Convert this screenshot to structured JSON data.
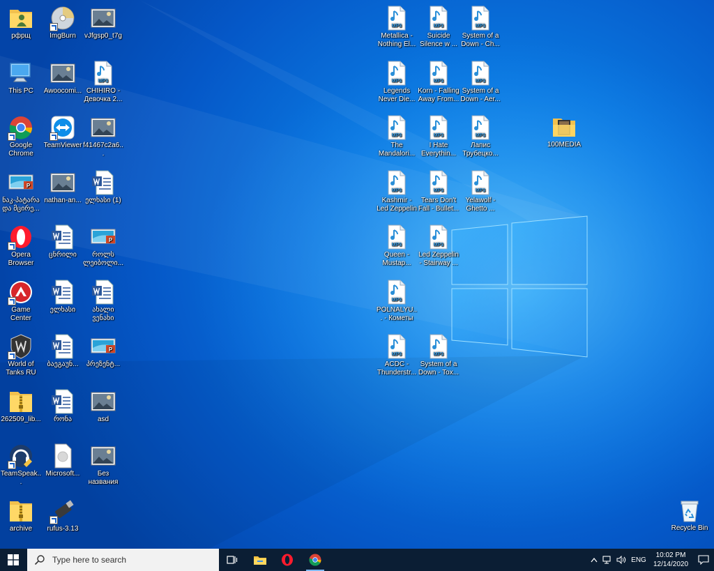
{
  "desktop": {
    "left_icons": [
      {
        "label": "рфрщ",
        "icon": "folder-user-icon"
      },
      {
        "label": "ImgBurn",
        "icon": "imgburn-disc-icon"
      },
      {
        "label": "vJfgsp0_t7g",
        "icon": "image-thumbnail-icon"
      },
      {
        "label": "This PC",
        "icon": "this-pc-icon"
      },
      {
        "label": "Awoocomi...",
        "icon": "image-thumbnail-icon"
      },
      {
        "label": "CHIHIRO - Девочка 2...",
        "icon": "mp3-file-icon"
      },
      {
        "label": "Google Chrome",
        "icon": "chrome-icon"
      },
      {
        "label": "TeamViewer",
        "icon": "teamviewer-icon"
      },
      {
        "label": "f41467c2a6...",
        "icon": "image-thumbnail-icon"
      },
      {
        "label": "ნაკ-პატარა და მცირე...",
        "icon": "powerpoint-file-icon"
      },
      {
        "label": "nathan-an...",
        "icon": "image-thumbnail-icon"
      },
      {
        "label": "ელხასი (1)",
        "icon": "word-file-icon"
      },
      {
        "label": "Opera Browser",
        "icon": "opera-icon"
      },
      {
        "label": "ცნრილი",
        "icon": "word-file-icon"
      },
      {
        "label": "როლს ლეიბოლი...",
        "icon": "powerpoint-file-icon"
      },
      {
        "label": "Game Center",
        "icon": "game-center-icon"
      },
      {
        "label": "ელხასი",
        "icon": "word-file-icon"
      },
      {
        "label": "ახალი ვენახი",
        "icon": "word-file-icon"
      },
      {
        "label": "World of Tanks RU",
        "icon": "world-of-tanks-icon"
      },
      {
        "label": "ბაეგაუნ...",
        "icon": "word-file-icon"
      },
      {
        "label": "პრეზენტ...",
        "icon": "powerpoint-file-icon"
      },
      {
        "label": "262509_lib...",
        "icon": "zip-folder-icon"
      },
      {
        "label": "რონა",
        "icon": "word-file-icon"
      },
      {
        "label": "asd",
        "icon": "image-thumbnail-icon"
      },
      {
        "label": "TeamSpeak...",
        "icon": "teamspeak-icon"
      },
      {
        "label": "Microsoft...",
        "icon": "generic-file-icon"
      },
      {
        "label": "Без названия",
        "icon": "image-thumbnail-icon"
      },
      {
        "label": "archive",
        "icon": "zip-folder-icon"
      },
      {
        "label": "rufus-3.13",
        "icon": "usb-drive-icon"
      }
    ],
    "mp3_icons": [
      {
        "label": "Metallica - Nothing El..."
      },
      {
        "label": "Suicide Silence w ..."
      },
      {
        "label": "System of a Down - Ch..."
      },
      {
        "label": "Legends Never Die..."
      },
      {
        "label": "Korn - Falling Away From..."
      },
      {
        "label": "System of a Down - Aer..."
      },
      {
        "label": "The Mandalori..."
      },
      {
        "label": "I Hate Everythin..."
      },
      {
        "label": "Лапис Трубецко..."
      },
      {
        "label": "Kashmir - Led Zeppelin"
      },
      {
        "label": "Tears Don't Fall - Bullet..."
      },
      {
        "label": "Yelawolf - Ghetto ..."
      },
      {
        "label": "Queen - Mustap..."
      },
      {
        "label": "Led Zeppelin - Stairway ..."
      },
      {
        "label": "POLNALYU... - Кометы (..."
      },
      {
        "label": "ACDC - Thunderstr..."
      },
      {
        "label": "System of a Down - Tox..."
      }
    ],
    "mp3_badge": "MP3",
    "folder_100media": {
      "label": "100MEDIA",
      "icon": "media-folder-icon"
    },
    "recycle_bin": {
      "label": "Recycle Bin",
      "icon": "recycle-bin-icon"
    }
  },
  "taskbar": {
    "search_placeholder": "Type here to search",
    "language": "ENG",
    "time": "10:02 PM",
    "date": "12/14/2020"
  },
  "colors": {
    "taskbar": "#0b1e34",
    "accent": "#0078d7"
  }
}
